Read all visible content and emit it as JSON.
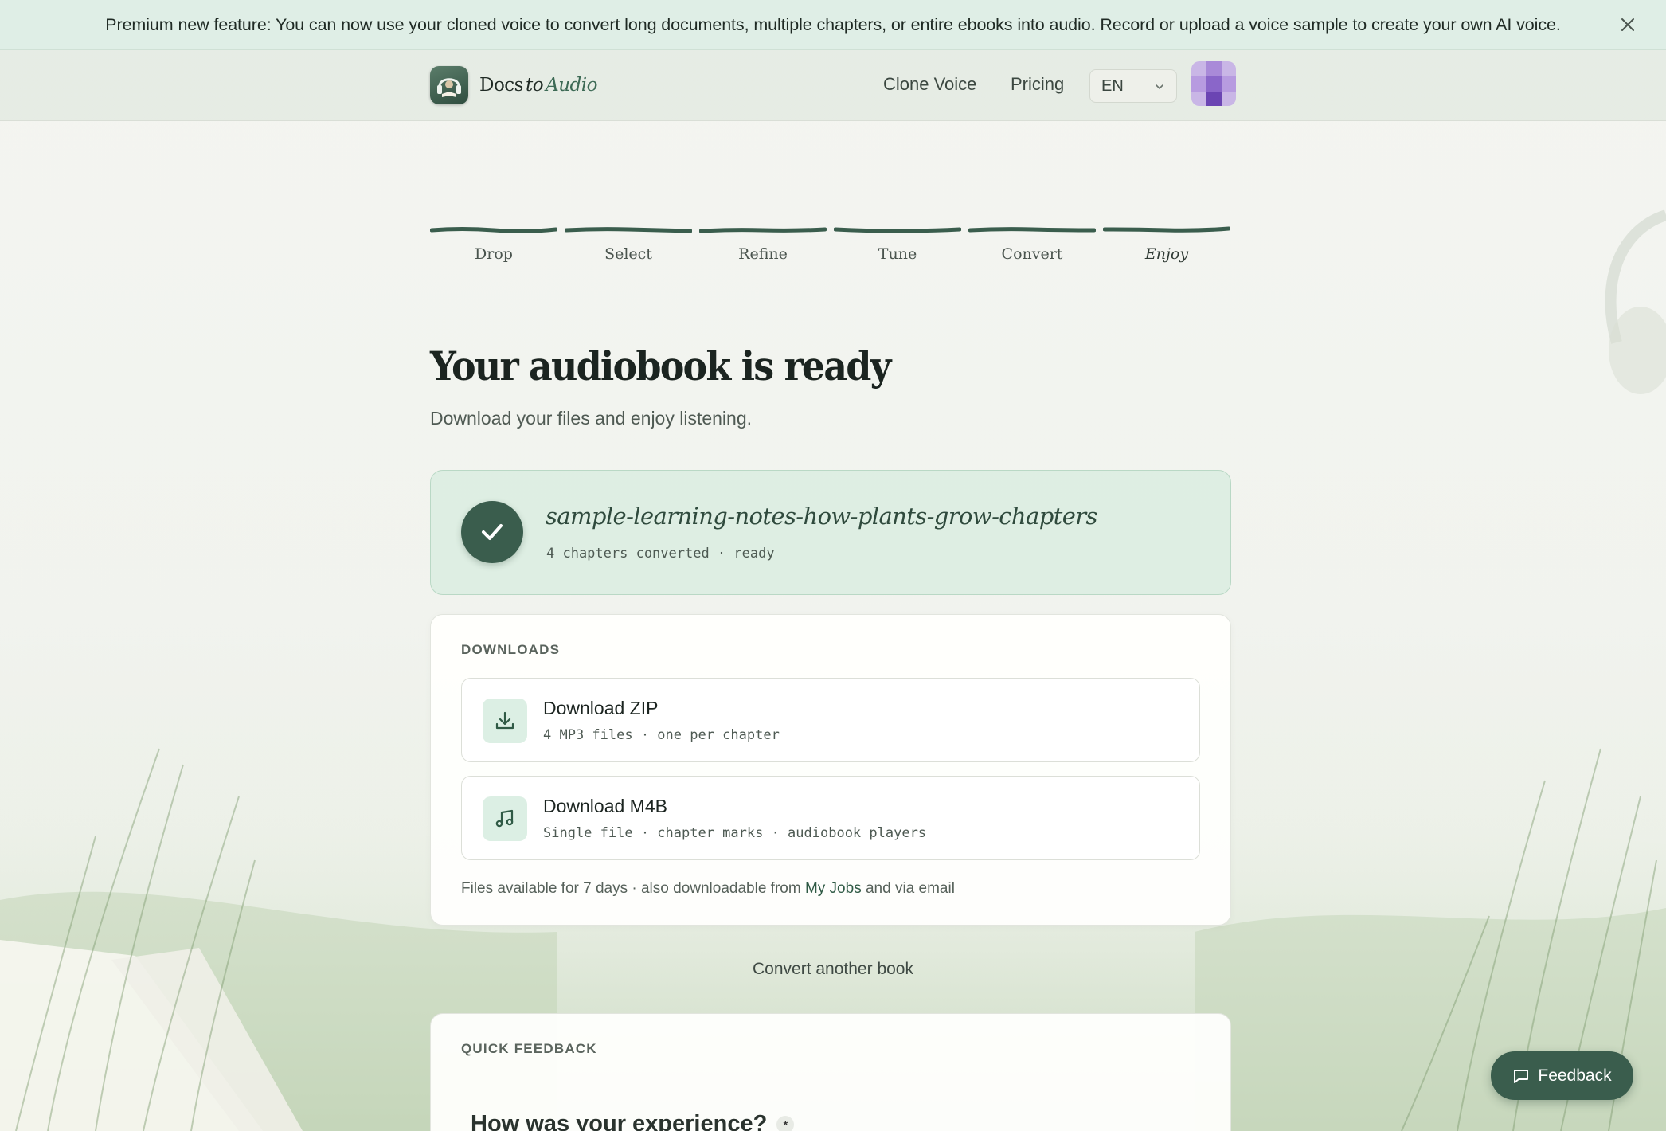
{
  "banner": {
    "text": "Premium new feature: You can now use your cloned voice to convert long documents, multiple chapters, or entire ebooks into audio. Record or upload a voice sample to create your own AI voice.",
    "close_icon": "close-icon"
  },
  "header": {
    "logo": {
      "word1": "Docs",
      "word2": "to",
      "word3": "Audio",
      "icon": "headphones-book-icon"
    },
    "nav": {
      "clone_voice": "Clone Voice",
      "pricing": "Pricing"
    },
    "language": {
      "selected": "EN",
      "icon": "chevron-down-icon"
    },
    "avatar_icon": "avatar"
  },
  "steps": [
    {
      "label": "Drop",
      "complete": true
    },
    {
      "label": "Select",
      "complete": true
    },
    {
      "label": "Refine",
      "complete": true
    },
    {
      "label": "Tune",
      "complete": true
    },
    {
      "label": "Convert",
      "complete": true
    },
    {
      "label": "Enjoy",
      "complete": true,
      "active": true
    }
  ],
  "main": {
    "title": "Your audiobook is ready",
    "subtitle": "Download your files and enjoy listening."
  },
  "ready_card": {
    "name": "sample-learning-notes-how-plants-grow-chapters",
    "meta": "4 chapters converted · ready",
    "icon": "check-icon"
  },
  "downloads": {
    "label": "DOWNLOADS",
    "zip": {
      "title": "Download ZIP",
      "subtitle": "4 MP3 files · one per chapter",
      "icon": "download-icon"
    },
    "m4b": {
      "title": "Download M4B",
      "subtitle": "Single file · chapter marks · audiobook players",
      "icon": "music-note-icon"
    },
    "note_before": "Files available for 7 days · also downloadable from ",
    "note_link": "My Jobs",
    "note_after": " and via email"
  },
  "convert_another": "Convert another book",
  "quick_feedback": {
    "label": "QUICK FEEDBACK",
    "question": "How was your experience?",
    "required_mark": "*"
  },
  "feedback_button": {
    "label": "Feedback",
    "icon": "message-icon"
  },
  "colors": {
    "accent": "#3a5d4d",
    "banner_bg": "#dfeee6",
    "ready_card_bg": "#dcefe4"
  }
}
